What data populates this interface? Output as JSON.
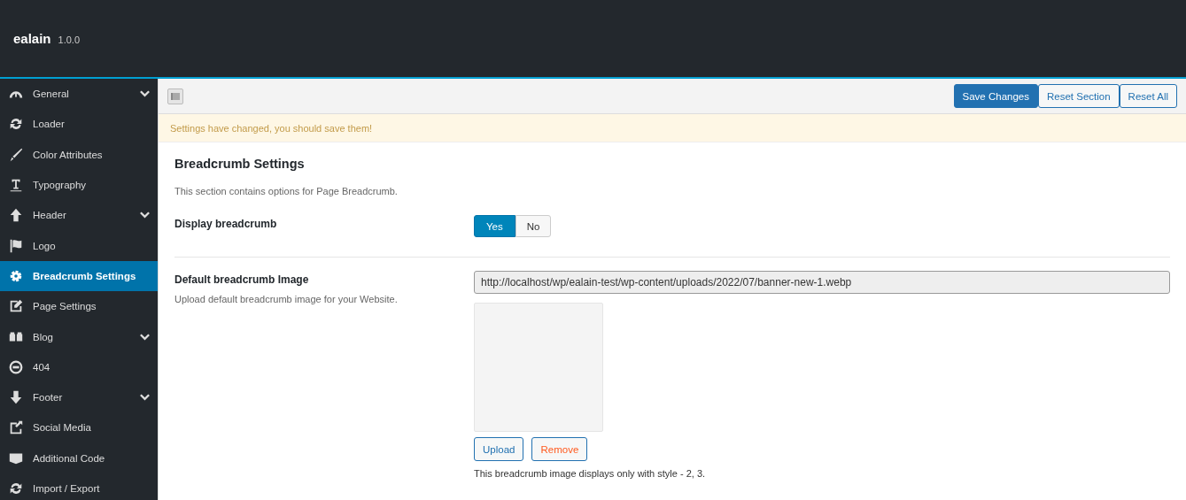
{
  "header": {
    "title": "ealain",
    "version": "1.0.0"
  },
  "sidebar": {
    "items": [
      {
        "label": "General",
        "selected": false,
        "submenu": true
      },
      {
        "label": "Loader",
        "selected": false,
        "submenu": false
      },
      {
        "label": "Color Attributes",
        "selected": false,
        "submenu": false
      },
      {
        "label": "Typography",
        "selected": false,
        "submenu": false
      },
      {
        "label": "Header",
        "selected": false,
        "submenu": true
      },
      {
        "label": "Logo",
        "selected": false,
        "submenu": false
      },
      {
        "label": "Breadcrumb Settings",
        "selected": true,
        "submenu": false
      },
      {
        "label": "Page Settings",
        "selected": false,
        "submenu": false
      },
      {
        "label": "Blog",
        "selected": false,
        "submenu": true
      },
      {
        "label": "404",
        "selected": false,
        "submenu": false
      },
      {
        "label": "Footer",
        "selected": false,
        "submenu": true
      },
      {
        "label": "Social Media",
        "selected": false,
        "submenu": false
      },
      {
        "label": "Additional Code",
        "selected": false,
        "submenu": false
      },
      {
        "label": "Import / Export",
        "selected": false,
        "submenu": false
      }
    ]
  },
  "toolbar": {
    "buttons": [
      {
        "label": "Save Changes",
        "kind": "primary"
      },
      {
        "label": "Reset Section",
        "kind": "secondary"
      },
      {
        "label": "Reset All",
        "kind": "secondary"
      }
    ]
  },
  "notice": "Settings have changed, you should save them!",
  "section": {
    "title": "Breadcrumb Settings",
    "description": "This section contains options for Page Breadcrumb.",
    "fields": [
      {
        "kind": "toggle",
        "label": "Display breadcrumb",
        "options": [
          {
            "label": "Yes",
            "selected": true
          },
          {
            "label": "No",
            "selected": false
          }
        ]
      },
      {
        "kind": "media",
        "label": "Default breadcrumb Image",
        "description": "Upload default breadcrumb image for your Website.",
        "value": "http://localhost/wp/ealain-test/wp-content/uploads/2022/07/banner-new-1.webp",
        "upload": "Upload",
        "remove": "Remove",
        "note": "This breadcrumb image displays only with style - 2, 3."
      }
    ]
  }
}
